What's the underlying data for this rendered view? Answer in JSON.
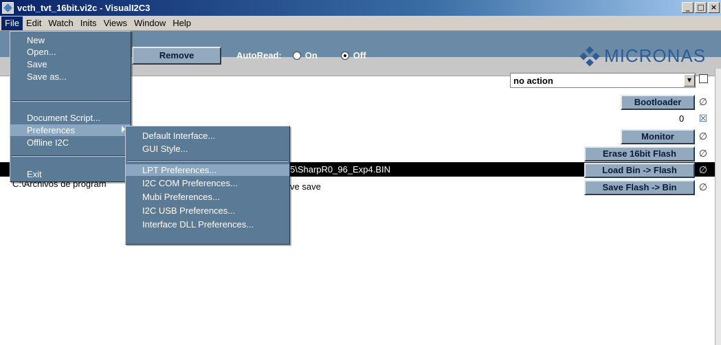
{
  "window": {
    "title": "vcth_tvt_16bit.vi2c - VisualI2C3",
    "controls": {
      "minimize": "_",
      "maximize": "□",
      "close": "×"
    }
  },
  "menubar": [
    "File",
    "Edit",
    "Watch",
    "Inits",
    "Views",
    "Window",
    "Help"
  ],
  "toolbar": {
    "remove_label": "Remove",
    "autoread_label": "AutoRead:",
    "autoread_on": "On",
    "autoread_off": "Off",
    "autoread_selected": "Off",
    "logo_text": "MICRONAS"
  },
  "action_select": {
    "value": "no action"
  },
  "buttons": {
    "bootloader": "Bootloader",
    "monitor": "Monitor",
    "erase": "Erase 16bit Flash",
    "load": "Load Bin -> Flash",
    "save": "Save Flash -> Bin"
  },
  "values": {
    "zero": "0"
  },
  "content": {
    "path_suffix": "5\\SharpR0_96_Exp4.BIN",
    "path_prefix": "C:\\Archivos de program",
    "save_note": "ve save"
  },
  "file_menu": {
    "items": [
      "New",
      "Open...",
      "Save",
      "Save as...",
      "Document Script...",
      "Preferences",
      "Offline I2C",
      "Exit"
    ],
    "active": "Preferences"
  },
  "preferences_menu": {
    "items": [
      "Default Interface...",
      "GUI Style...",
      "LPT Preferences...",
      "I2C COM Preferences...",
      "Mubi Preferences...",
      "I2C USB Preferences...",
      "Interface DLL Preferences..."
    ],
    "active": "LPT Preferences..."
  },
  "icons": {
    "status": "null-circle-icon",
    "checked": "checked-box-icon",
    "submenu": "submenu-arrow-icon"
  }
}
